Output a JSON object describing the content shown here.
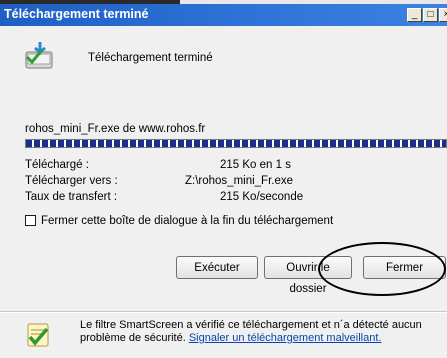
{
  "window": {
    "title": "Téléchargement terminé"
  },
  "header": {
    "text": "Téléchargement terminé"
  },
  "file": {
    "line": "rohos_mini_Fr.exe de www.rohos.fr",
    "progress_percent": 100
  },
  "details": {
    "downloaded_label": "Téléchargé :",
    "downloaded_value": "215 Ko en 1 s",
    "target_label": "Télécharger vers :",
    "target_value": "Z:\\rohos_mini_Fr.exe",
    "rate_label": "Taux de transfert :",
    "rate_value": "215 Ko/seconde"
  },
  "close_checkbox": {
    "label": "Fermer cette boîte de dialogue à la fin du téléchargement",
    "checked": false
  },
  "buttons": {
    "run": "Exécuter",
    "open_folder": "Ouvrir le dossier",
    "close": "Fermer"
  },
  "smartscreen": {
    "text": "Le filtre SmartScreen a vérifié ce téléchargement et n´a détecté aucun problème de sécurité.",
    "link": "Signaler un téléchargement malveillant."
  },
  "icons": [
    "download-complete-icon",
    "smartscreen-shield-icon",
    "minimize-icon",
    "maximize-icon",
    "close-icon"
  ]
}
